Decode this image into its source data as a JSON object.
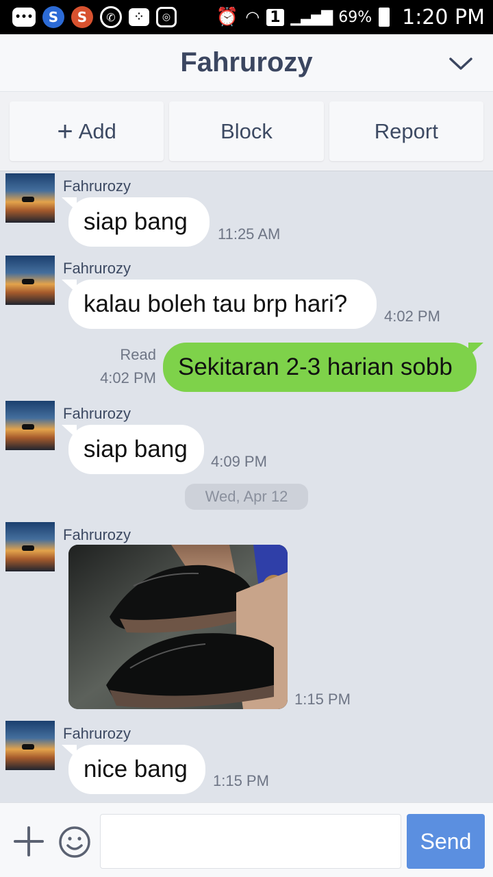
{
  "status_bar": {
    "battery": "69%",
    "time": "1:20 PM",
    "sim_label": "1"
  },
  "header": {
    "title": "Fahrurozy"
  },
  "actions": {
    "add_label": "Add",
    "block_label": "Block",
    "report_label": "Report"
  },
  "messages": [
    {
      "sender": "Fahrurozy",
      "text": "siap bang",
      "time": "11:25 AM"
    },
    {
      "sender": "Fahrurozy",
      "text": "kalau boleh tau brp hari?",
      "time": "4:02 PM"
    },
    {
      "read": "Read",
      "text": "Sekitaran 2-3 harian sobb",
      "time": "4:02 PM"
    },
    {
      "sender": "Fahrurozy",
      "text": "siap bang",
      "time": "4:09 PM"
    },
    {
      "sender": "Fahrurozy",
      "time": "1:15 PM"
    },
    {
      "sender": "Fahrurozy",
      "text": "nice bang",
      "time": "1:15 PM"
    }
  ],
  "date_separator": "Wed, Apr 12",
  "input": {
    "send_label": "Send",
    "value": ""
  },
  "colors": {
    "outgoing_bubble": "#7ed24a",
    "send_button": "#5b8fe0",
    "chat_background": "#dfe3ea"
  }
}
